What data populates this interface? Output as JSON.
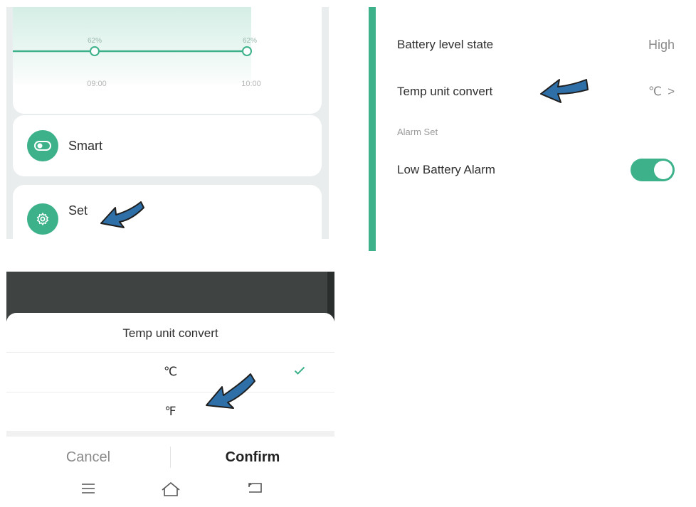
{
  "chart": {
    "points": [
      {
        "label": "62%",
        "time": "09:00"
      },
      {
        "label": "62%",
        "time": "10:00"
      }
    ],
    "line_color": "#3db28a"
  },
  "home": {
    "smart_label": "Smart",
    "set_label": "Set"
  },
  "settings": {
    "battery_label": "Battery level state",
    "battery_value": "High",
    "temp_label": "Temp unit convert",
    "temp_value": "℃",
    "temp_chevron": ">",
    "alarm_section": "Alarm Set",
    "low_battery_label": "Low Battery Alarm",
    "low_battery_on": true
  },
  "modal": {
    "title": "Temp unit convert",
    "options": [
      {
        "label": "℃",
        "selected": true
      },
      {
        "label": "℉",
        "selected": false
      }
    ],
    "cancel_label": "Cancel",
    "confirm_label": "Confirm"
  },
  "nav": {
    "icons": [
      "menu-icon",
      "home-icon",
      "back-icon"
    ]
  },
  "colors": {
    "accent": "#3db28a",
    "arrow": "#2f6fa8"
  }
}
